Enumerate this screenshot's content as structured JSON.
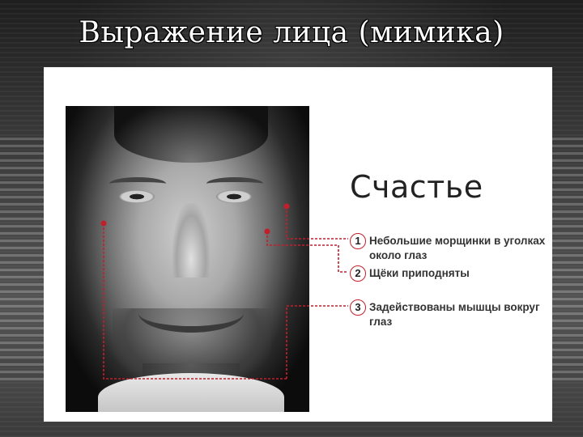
{
  "slide": {
    "title": "Выражение лица (мимика)"
  },
  "figure": {
    "heading": "Счастье",
    "items": [
      {
        "number": "1",
        "text": "Небольшие морщинки в уголках около глаз"
      },
      {
        "number": "2",
        "text": "Щёки приподняты"
      },
      {
        "number": "3",
        "text": "Задействованы мышцы вокруг глаз"
      }
    ],
    "marker_color": "#c21f2a"
  }
}
